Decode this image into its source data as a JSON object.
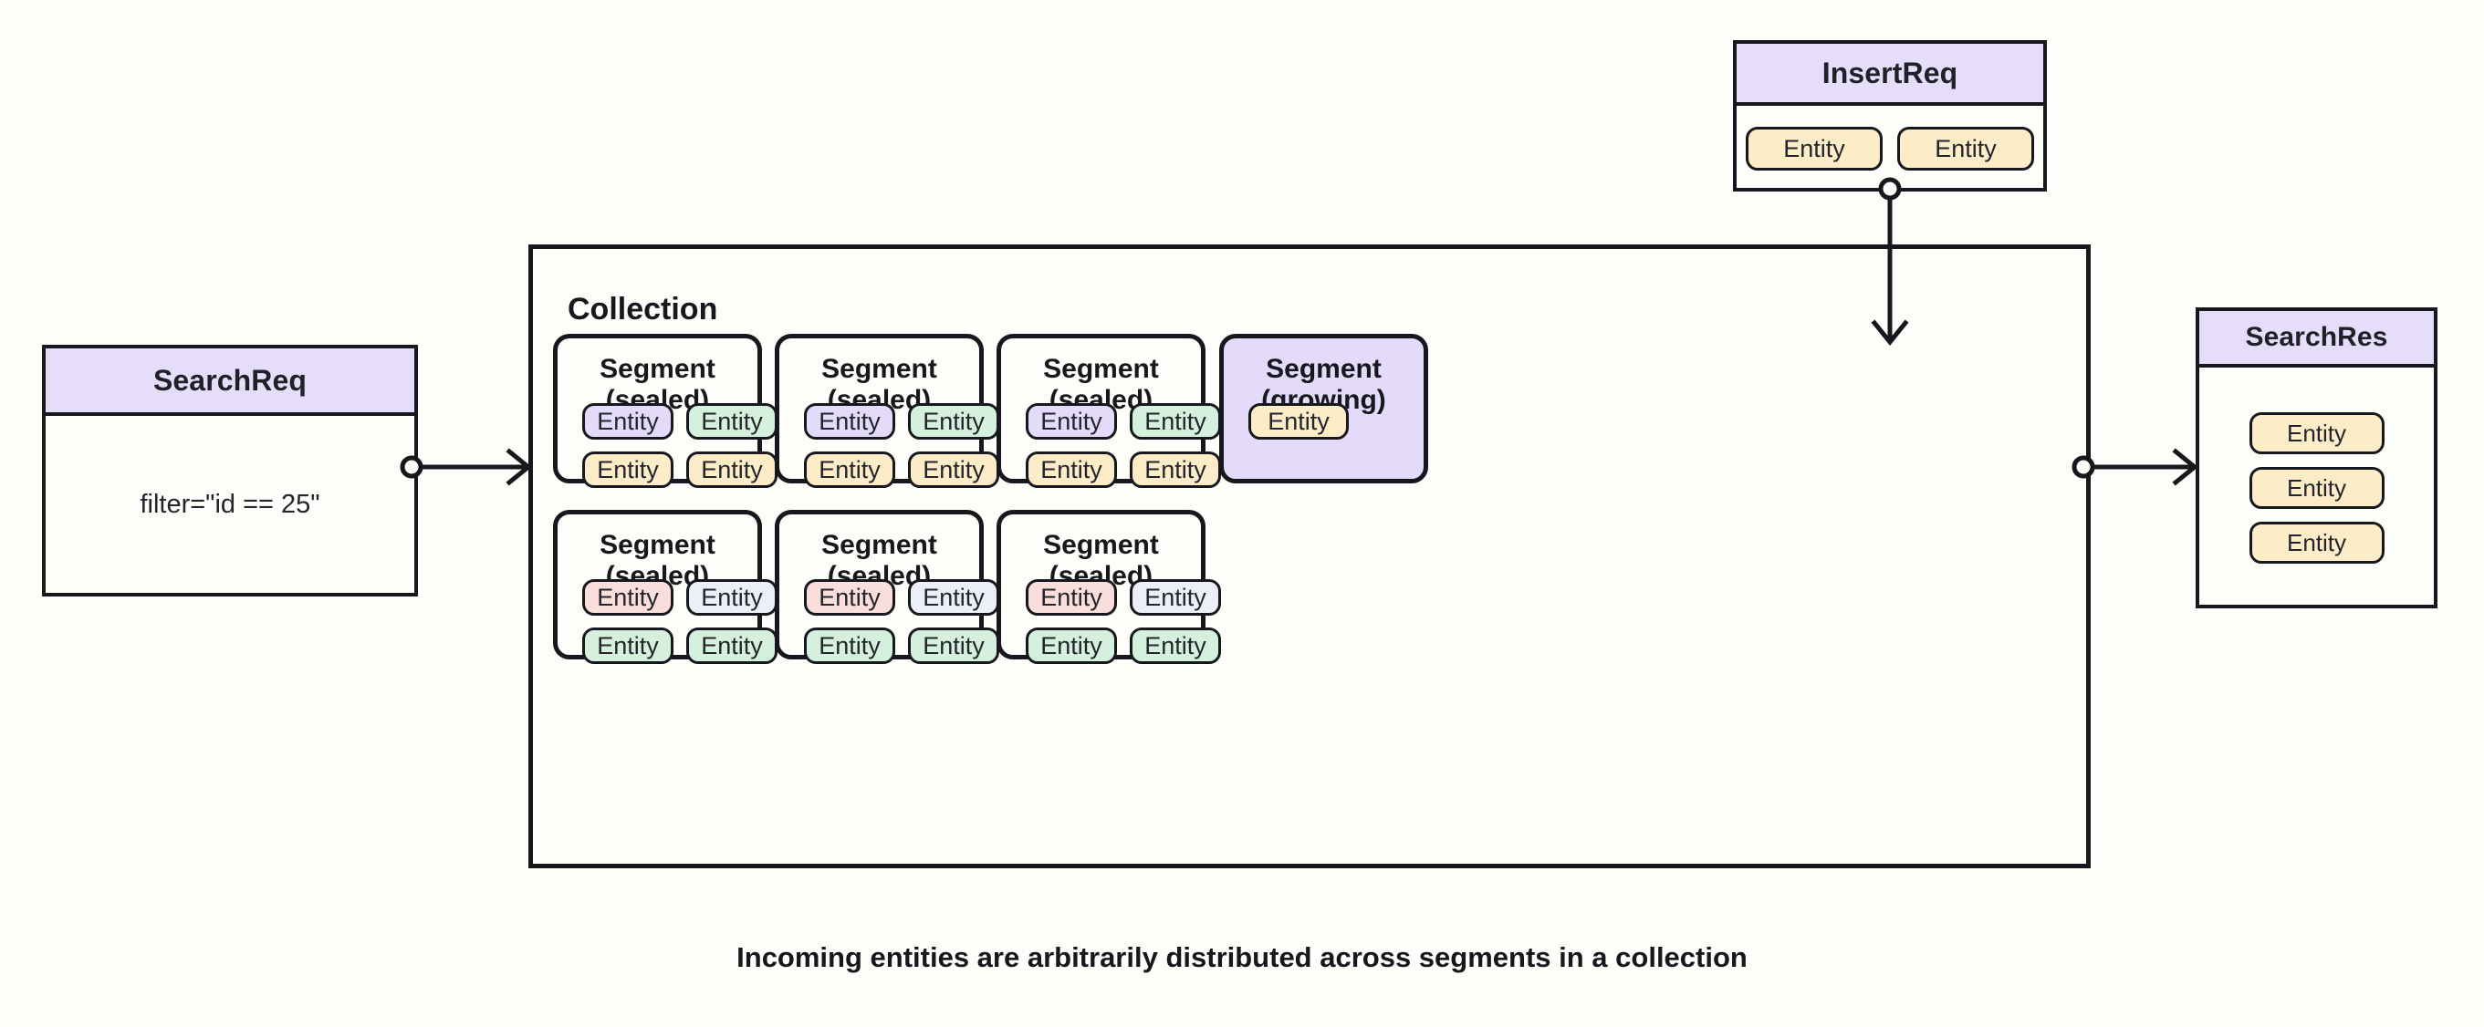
{
  "canvas": {
    "background": "#fdfdfa",
    "stroke": "#16181d",
    "caption": "Incoming entities are arbitrarily distributed across segments in a collection"
  },
  "palette": {
    "header_purple": "#e6ddfb",
    "chip_yellow": "#fcecc7",
    "chip_purple": "#e4daf9",
    "chip_green": "#d5f0dc",
    "chip_pink": "#fadedc",
    "chip_blue": "#eceff7",
    "growing_fill": "#e4daf9"
  },
  "search_request": {
    "title": "SearchReq",
    "filter": "filter=\"id == 25\""
  },
  "insert_request": {
    "title": "InsertReq",
    "entities": [
      {
        "label": "Entity",
        "color": "yellow"
      },
      {
        "label": "Entity",
        "color": "yellow"
      }
    ]
  },
  "search_response": {
    "title": "SearchRes",
    "entities": [
      {
        "label": "Entity",
        "color": "yellow"
      },
      {
        "label": "Entity",
        "color": "yellow"
      },
      {
        "label": "Entity",
        "color": "yellow"
      }
    ]
  },
  "collection": {
    "label": "Collection",
    "segments": [
      {
        "title": "Segment (sealed)",
        "state": "sealed",
        "entities": [
          {
            "label": "Entity",
            "color": "purple"
          },
          {
            "label": "Entity",
            "color": "green"
          },
          {
            "label": "Entity",
            "color": "yellow"
          },
          {
            "label": "Entity",
            "color": "yellow"
          }
        ]
      },
      {
        "title": "Segment (sealed)",
        "state": "sealed",
        "entities": [
          {
            "label": "Entity",
            "color": "purple"
          },
          {
            "label": "Entity",
            "color": "green"
          },
          {
            "label": "Entity",
            "color": "yellow"
          },
          {
            "label": "Entity",
            "color": "yellow"
          }
        ]
      },
      {
        "title": "Segment (sealed)",
        "state": "sealed",
        "entities": [
          {
            "label": "Entity",
            "color": "purple"
          },
          {
            "label": "Entity",
            "color": "green"
          },
          {
            "label": "Entity",
            "color": "yellow"
          },
          {
            "label": "Entity",
            "color": "yellow"
          }
        ]
      },
      {
        "title": "Segment (growing)",
        "state": "growing",
        "entities": [
          {
            "label": "Entity",
            "color": "yellow"
          }
        ]
      },
      {
        "title": "Segment (sealed)",
        "state": "sealed",
        "entities": [
          {
            "label": "Entity",
            "color": "pink"
          },
          {
            "label": "Entity",
            "color": "blue"
          },
          {
            "label": "Entity",
            "color": "green"
          },
          {
            "label": "Entity",
            "color": "green"
          }
        ]
      },
      {
        "title": "Segment (sealed)",
        "state": "sealed",
        "entities": [
          {
            "label": "Entity",
            "color": "pink"
          },
          {
            "label": "Entity",
            "color": "blue"
          },
          {
            "label": "Entity",
            "color": "green"
          },
          {
            "label": "Entity",
            "color": "green"
          }
        ]
      },
      {
        "title": "Segment (sealed)",
        "state": "sealed",
        "entities": [
          {
            "label": "Entity",
            "color": "pink"
          },
          {
            "label": "Entity",
            "color": "blue"
          },
          {
            "label": "Entity",
            "color": "green"
          },
          {
            "label": "Entity",
            "color": "green"
          }
        ]
      }
    ]
  },
  "connectors": [
    {
      "name": "searchreq-to-collection",
      "from": "SearchReq",
      "to": "Collection",
      "direction": "right"
    },
    {
      "name": "insertreq-to-growing-segment",
      "from": "InsertReq",
      "to": "Segment (growing)",
      "direction": "down"
    },
    {
      "name": "collection-to-searchres",
      "from": "Collection",
      "to": "SearchRes",
      "direction": "right"
    }
  ]
}
